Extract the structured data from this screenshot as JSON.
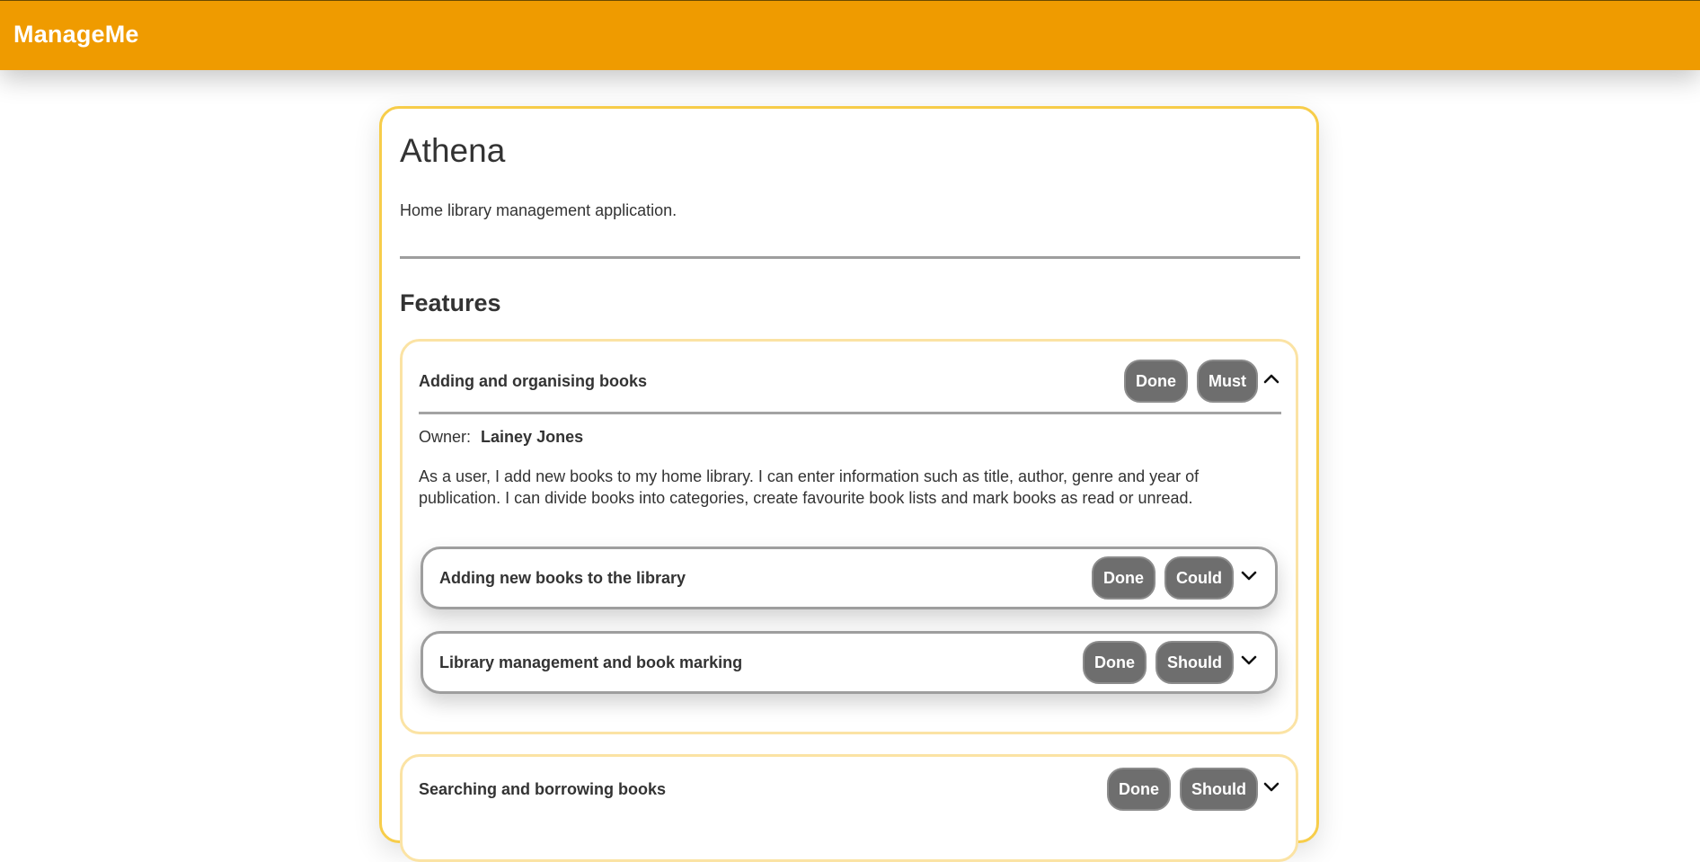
{
  "app": {
    "brand": "ManageMe",
    "accent": "#ef9b00"
  },
  "project": {
    "title": "Athena",
    "description": "Home library management application.",
    "features_heading": "Features"
  },
  "features": [
    {
      "name": "Adding and organising books",
      "status": "Done",
      "priority": "Must",
      "expanded": true,
      "owner_label": "Owner:",
      "owner": "Lainey Jones",
      "description": "As a user, I add new books to my home library. I can enter information such as title, author, genre and year of publication. I can divide books into categories, create favourite book lists and mark books as read or unread.",
      "tasks": [
        {
          "name": "Adding new books to the library",
          "status": "Done",
          "priority": "Could"
        },
        {
          "name": "Library management and book marking",
          "status": "Done",
          "priority": "Should"
        }
      ]
    },
    {
      "name": "Searching and borrowing books",
      "status": "Done",
      "priority": "Should",
      "expanded": false
    }
  ],
  "icons": {
    "collapse": "chevron-up-icon",
    "expand": "chevron-down-icon"
  }
}
